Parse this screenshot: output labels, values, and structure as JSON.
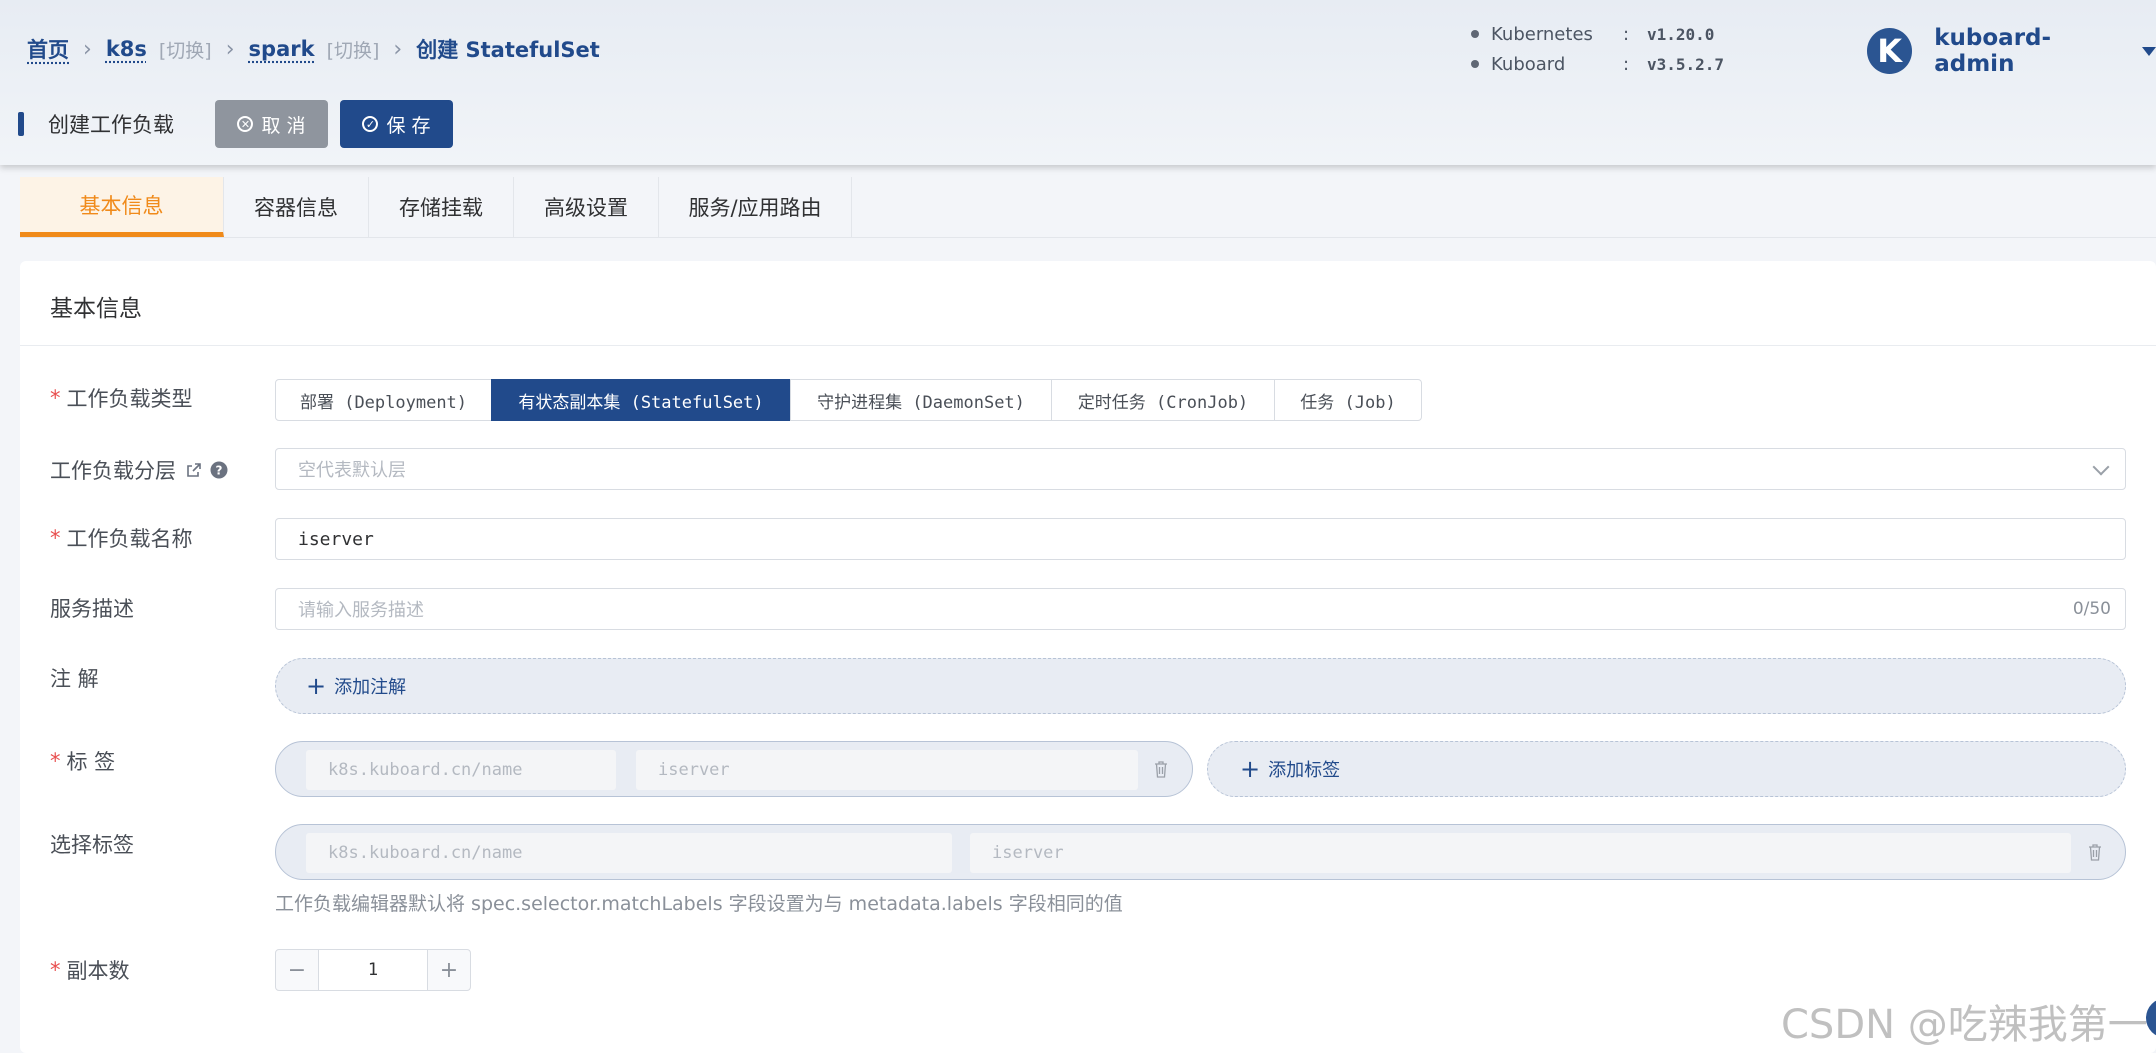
{
  "breadcrumb": {
    "home": "首页",
    "cluster": "k8s",
    "cluster_switch": "[切换]",
    "namespace": "spark",
    "namespace_switch": "[切换]",
    "current": "创建 StatefulSet"
  },
  "versions": [
    {
      "name": "Kubernetes",
      "colon": ":",
      "value": "v1.20.0"
    },
    {
      "name": "Kuboard",
      "colon": ":",
      "value": "v3.5.2.7"
    }
  ],
  "user": {
    "avatar_letter": "K",
    "name": "kuboard-admin"
  },
  "action_bar": {
    "title": "创建工作负载",
    "cancel_label": "取 消",
    "save_label": "保 存"
  },
  "tabs": [
    "基本信息",
    "容器信息",
    "存储挂载",
    "高级设置",
    "服务/应用路由"
  ],
  "section": {
    "title": "基本信息"
  },
  "form": {
    "workload_type_label": "工作负载类型",
    "workload_types": [
      "部署 (Deployment)",
      "有状态副本集 (StatefulSet)",
      "守护进程集 (DaemonSet)",
      "定时任务 (CronJob)",
      "任务 (Job)"
    ],
    "workload_type_selected": "有状态副本集 (StatefulSet)",
    "layer_label": "工作负载分层",
    "layer_placeholder": "空代表默认层",
    "name_label": "工作负载名称",
    "name_value": "iserver",
    "desc_label": "服务描述",
    "desc_placeholder": "请输入服务描述",
    "desc_counter": "0/50",
    "annotation_label": "注 解",
    "add_annotation": "添加注解",
    "labels_label": "标 签",
    "label_key_placeholder": "k8s.kuboard.cn/name",
    "label_value_placeholder": "iserver",
    "add_label": "添加标签",
    "selector_label": "选择标签",
    "selector_key_placeholder": "k8s.kuboard.cn/name",
    "selector_value_placeholder": "iserver",
    "selector_help": "工作负载编辑器默认将 spec.selector.matchLabels 字段设置为与 metadata.labels 字段相同的值",
    "replicas_label": "副本数",
    "replicas_value": "1",
    "minus": "−",
    "plus": "+"
  },
  "watermark": "CSDN @吃辣我第一",
  "colors": {
    "primary": "#214a8b",
    "active_tab": "#f08a1a",
    "required": "#e84f4f"
  }
}
